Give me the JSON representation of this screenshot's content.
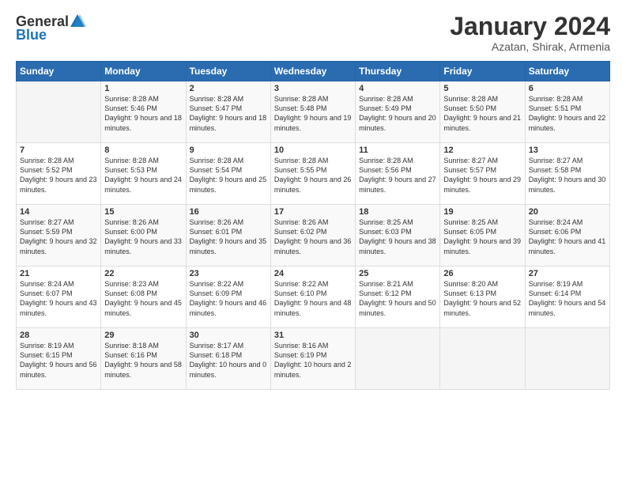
{
  "logo": {
    "general": "General",
    "blue": "Blue"
  },
  "header": {
    "title": "January 2024",
    "location": "Azatan, Shirak, Armenia"
  },
  "weekdays": [
    "Sunday",
    "Monday",
    "Tuesday",
    "Wednesday",
    "Thursday",
    "Friday",
    "Saturday"
  ],
  "weeks": [
    [
      {
        "day": "",
        "sunrise": "",
        "sunset": "",
        "daylight": ""
      },
      {
        "day": "1",
        "sunrise": "Sunrise: 8:28 AM",
        "sunset": "Sunset: 5:46 PM",
        "daylight": "Daylight: 9 hours and 18 minutes."
      },
      {
        "day": "2",
        "sunrise": "Sunrise: 8:28 AM",
        "sunset": "Sunset: 5:47 PM",
        "daylight": "Daylight: 9 hours and 18 minutes."
      },
      {
        "day": "3",
        "sunrise": "Sunrise: 8:28 AM",
        "sunset": "Sunset: 5:48 PM",
        "daylight": "Daylight: 9 hours and 19 minutes."
      },
      {
        "day": "4",
        "sunrise": "Sunrise: 8:28 AM",
        "sunset": "Sunset: 5:49 PM",
        "daylight": "Daylight: 9 hours and 20 minutes."
      },
      {
        "day": "5",
        "sunrise": "Sunrise: 8:28 AM",
        "sunset": "Sunset: 5:50 PM",
        "daylight": "Daylight: 9 hours and 21 minutes."
      },
      {
        "day": "6",
        "sunrise": "Sunrise: 8:28 AM",
        "sunset": "Sunset: 5:51 PM",
        "daylight": "Daylight: 9 hours and 22 minutes."
      }
    ],
    [
      {
        "day": "7",
        "sunrise": "Sunrise: 8:28 AM",
        "sunset": "Sunset: 5:52 PM",
        "daylight": "Daylight: 9 hours and 23 minutes."
      },
      {
        "day": "8",
        "sunrise": "Sunrise: 8:28 AM",
        "sunset": "Sunset: 5:53 PM",
        "daylight": "Daylight: 9 hours and 24 minutes."
      },
      {
        "day": "9",
        "sunrise": "Sunrise: 8:28 AM",
        "sunset": "Sunset: 5:54 PM",
        "daylight": "Daylight: 9 hours and 25 minutes."
      },
      {
        "day": "10",
        "sunrise": "Sunrise: 8:28 AM",
        "sunset": "Sunset: 5:55 PM",
        "daylight": "Daylight: 9 hours and 26 minutes."
      },
      {
        "day": "11",
        "sunrise": "Sunrise: 8:28 AM",
        "sunset": "Sunset: 5:56 PM",
        "daylight": "Daylight: 9 hours and 27 minutes."
      },
      {
        "day": "12",
        "sunrise": "Sunrise: 8:27 AM",
        "sunset": "Sunset: 5:57 PM",
        "daylight": "Daylight: 9 hours and 29 minutes."
      },
      {
        "day": "13",
        "sunrise": "Sunrise: 8:27 AM",
        "sunset": "Sunset: 5:58 PM",
        "daylight": "Daylight: 9 hours and 30 minutes."
      }
    ],
    [
      {
        "day": "14",
        "sunrise": "Sunrise: 8:27 AM",
        "sunset": "Sunset: 5:59 PM",
        "daylight": "Daylight: 9 hours and 32 minutes."
      },
      {
        "day": "15",
        "sunrise": "Sunrise: 8:26 AM",
        "sunset": "Sunset: 6:00 PM",
        "daylight": "Daylight: 9 hours and 33 minutes."
      },
      {
        "day": "16",
        "sunrise": "Sunrise: 8:26 AM",
        "sunset": "Sunset: 6:01 PM",
        "daylight": "Daylight: 9 hours and 35 minutes."
      },
      {
        "day": "17",
        "sunrise": "Sunrise: 8:26 AM",
        "sunset": "Sunset: 6:02 PM",
        "daylight": "Daylight: 9 hours and 36 minutes."
      },
      {
        "day": "18",
        "sunrise": "Sunrise: 8:25 AM",
        "sunset": "Sunset: 6:03 PM",
        "daylight": "Daylight: 9 hours and 38 minutes."
      },
      {
        "day": "19",
        "sunrise": "Sunrise: 8:25 AM",
        "sunset": "Sunset: 6:05 PM",
        "daylight": "Daylight: 9 hours and 39 minutes."
      },
      {
        "day": "20",
        "sunrise": "Sunrise: 8:24 AM",
        "sunset": "Sunset: 6:06 PM",
        "daylight": "Daylight: 9 hours and 41 minutes."
      }
    ],
    [
      {
        "day": "21",
        "sunrise": "Sunrise: 8:24 AM",
        "sunset": "Sunset: 6:07 PM",
        "daylight": "Daylight: 9 hours and 43 minutes."
      },
      {
        "day": "22",
        "sunrise": "Sunrise: 8:23 AM",
        "sunset": "Sunset: 6:08 PM",
        "daylight": "Daylight: 9 hours and 45 minutes."
      },
      {
        "day": "23",
        "sunrise": "Sunrise: 8:22 AM",
        "sunset": "Sunset: 6:09 PM",
        "daylight": "Daylight: 9 hours and 46 minutes."
      },
      {
        "day": "24",
        "sunrise": "Sunrise: 8:22 AM",
        "sunset": "Sunset: 6:10 PM",
        "daylight": "Daylight: 9 hours and 48 minutes."
      },
      {
        "day": "25",
        "sunrise": "Sunrise: 8:21 AM",
        "sunset": "Sunset: 6:12 PM",
        "daylight": "Daylight: 9 hours and 50 minutes."
      },
      {
        "day": "26",
        "sunrise": "Sunrise: 8:20 AM",
        "sunset": "Sunset: 6:13 PM",
        "daylight": "Daylight: 9 hours and 52 minutes."
      },
      {
        "day": "27",
        "sunrise": "Sunrise: 8:19 AM",
        "sunset": "Sunset: 6:14 PM",
        "daylight": "Daylight: 9 hours and 54 minutes."
      }
    ],
    [
      {
        "day": "28",
        "sunrise": "Sunrise: 8:19 AM",
        "sunset": "Sunset: 6:15 PM",
        "daylight": "Daylight: 9 hours and 56 minutes."
      },
      {
        "day": "29",
        "sunrise": "Sunrise: 8:18 AM",
        "sunset": "Sunset: 6:16 PM",
        "daylight": "Daylight: 9 hours and 58 minutes."
      },
      {
        "day": "30",
        "sunrise": "Sunrise: 8:17 AM",
        "sunset": "Sunset: 6:18 PM",
        "daylight": "Daylight: 10 hours and 0 minutes."
      },
      {
        "day": "31",
        "sunrise": "Sunrise: 8:16 AM",
        "sunset": "Sunset: 6:19 PM",
        "daylight": "Daylight: 10 hours and 2 minutes."
      },
      {
        "day": "",
        "sunrise": "",
        "sunset": "",
        "daylight": ""
      },
      {
        "day": "",
        "sunrise": "",
        "sunset": "",
        "daylight": ""
      },
      {
        "day": "",
        "sunrise": "",
        "sunset": "",
        "daylight": ""
      }
    ]
  ]
}
